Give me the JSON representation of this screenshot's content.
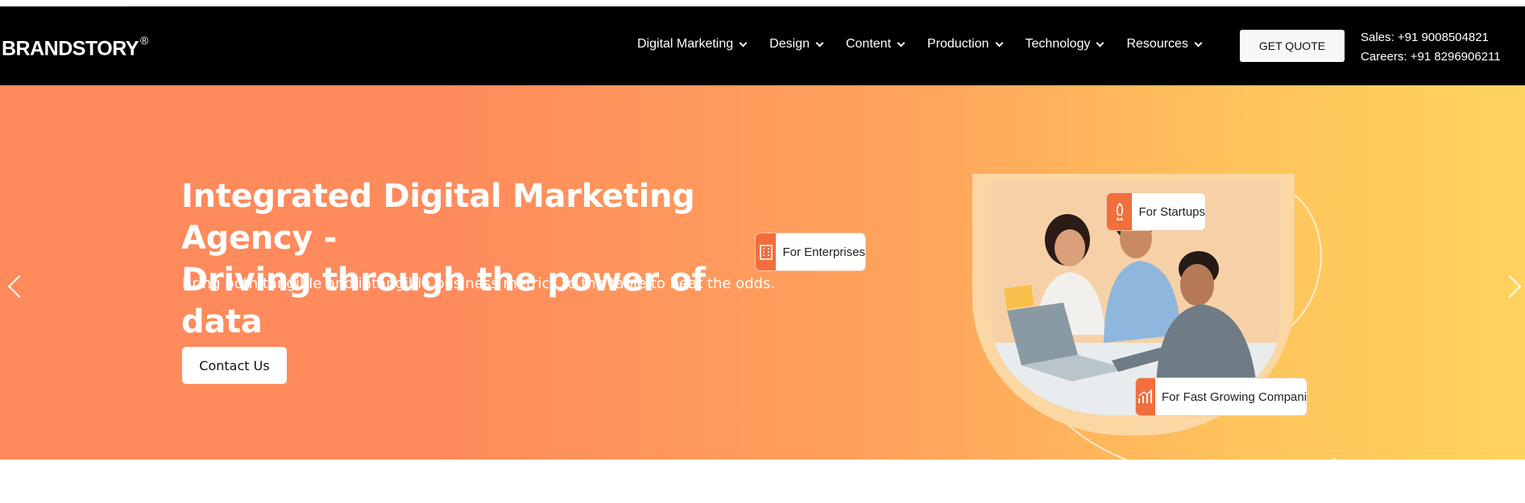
{
  "brand": {
    "name": "BRANDSTORY",
    "mark": "®"
  },
  "nav": [
    {
      "label": "Digital Marketing"
    },
    {
      "label": "Design"
    },
    {
      "label": "Content"
    },
    {
      "label": "Production"
    },
    {
      "label": "Technology"
    },
    {
      "label": "Resources"
    }
  ],
  "header": {
    "quote_label": "GET QUOTE",
    "sales": "Sales: +91 9008504821",
    "careers": "Careers: +91 8296906211"
  },
  "hero": {
    "headline_line1": "Integrated Digital Marketing Agency -",
    "headline_line2": "Driving through the power of data",
    "subline": "Bring both tangible and intangible business metrics to the table to beat the odds.",
    "cta_label": "Contact Us",
    "tags": {
      "startups": "For Startups",
      "enterprises": "For Enterprises",
      "fast_growing": "For Fast Growing Companies"
    }
  },
  "colors": {
    "header_bg": "#000000",
    "accent": "#f26e3c",
    "gradient_start": "#ff8a5c",
    "gradient_end": "#ffd35d"
  }
}
